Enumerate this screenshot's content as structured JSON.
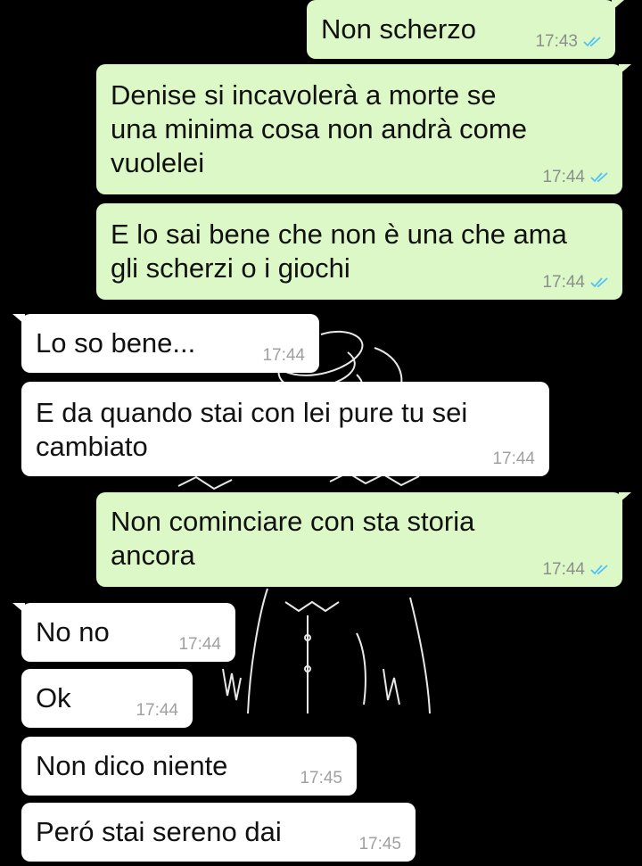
{
  "chat": {
    "messages": [
      {
        "id": "m1",
        "direction": "outgoing",
        "text": "Non scherzo",
        "time": "17:43",
        "status": "read-double-check"
      },
      {
        "id": "m2",
        "direction": "outgoing",
        "text": "Denise si incavolerà a morte se\nuna minima cosa non andrà come\nvuolelei",
        "time": "17:44",
        "status": "read-double-check"
      },
      {
        "id": "m3",
        "direction": "outgoing",
        "text": "E lo sai bene che non è una che ama\ngli scherzi o i giochi",
        "time": "17:44",
        "status": "read-double-check"
      },
      {
        "id": "m4",
        "direction": "incoming",
        "text": "Lo so bene...",
        "time": "17:44"
      },
      {
        "id": "m5",
        "direction": "incoming",
        "text": "E da quando stai con lei pure tu sei\ncambiato",
        "time": "17:44"
      },
      {
        "id": "m6",
        "direction": "outgoing",
        "text": "Non cominciare con sta storia\nancora",
        "time": "17:44",
        "status": "read-double-check"
      },
      {
        "id": "m7",
        "direction": "incoming",
        "text": "No no",
        "time": "17:44"
      },
      {
        "id": "m8",
        "direction": "incoming",
        "text": "Ok",
        "time": "17:44"
      },
      {
        "id": "m9",
        "direction": "incoming",
        "text": "Non dico niente",
        "time": "17:45"
      },
      {
        "id": "m10",
        "direction": "incoming",
        "text": "Peró stai sereno dai",
        "time": "17:45"
      }
    ]
  },
  "colors": {
    "background": "#000000",
    "outgoing_bubble": "#dcf8c6",
    "incoming_bubble": "#ffffff",
    "read_tick": "#4fc3f7",
    "timestamp": "#8b8f8b"
  },
  "background_art": "line-drawing-figure-white-on-black"
}
